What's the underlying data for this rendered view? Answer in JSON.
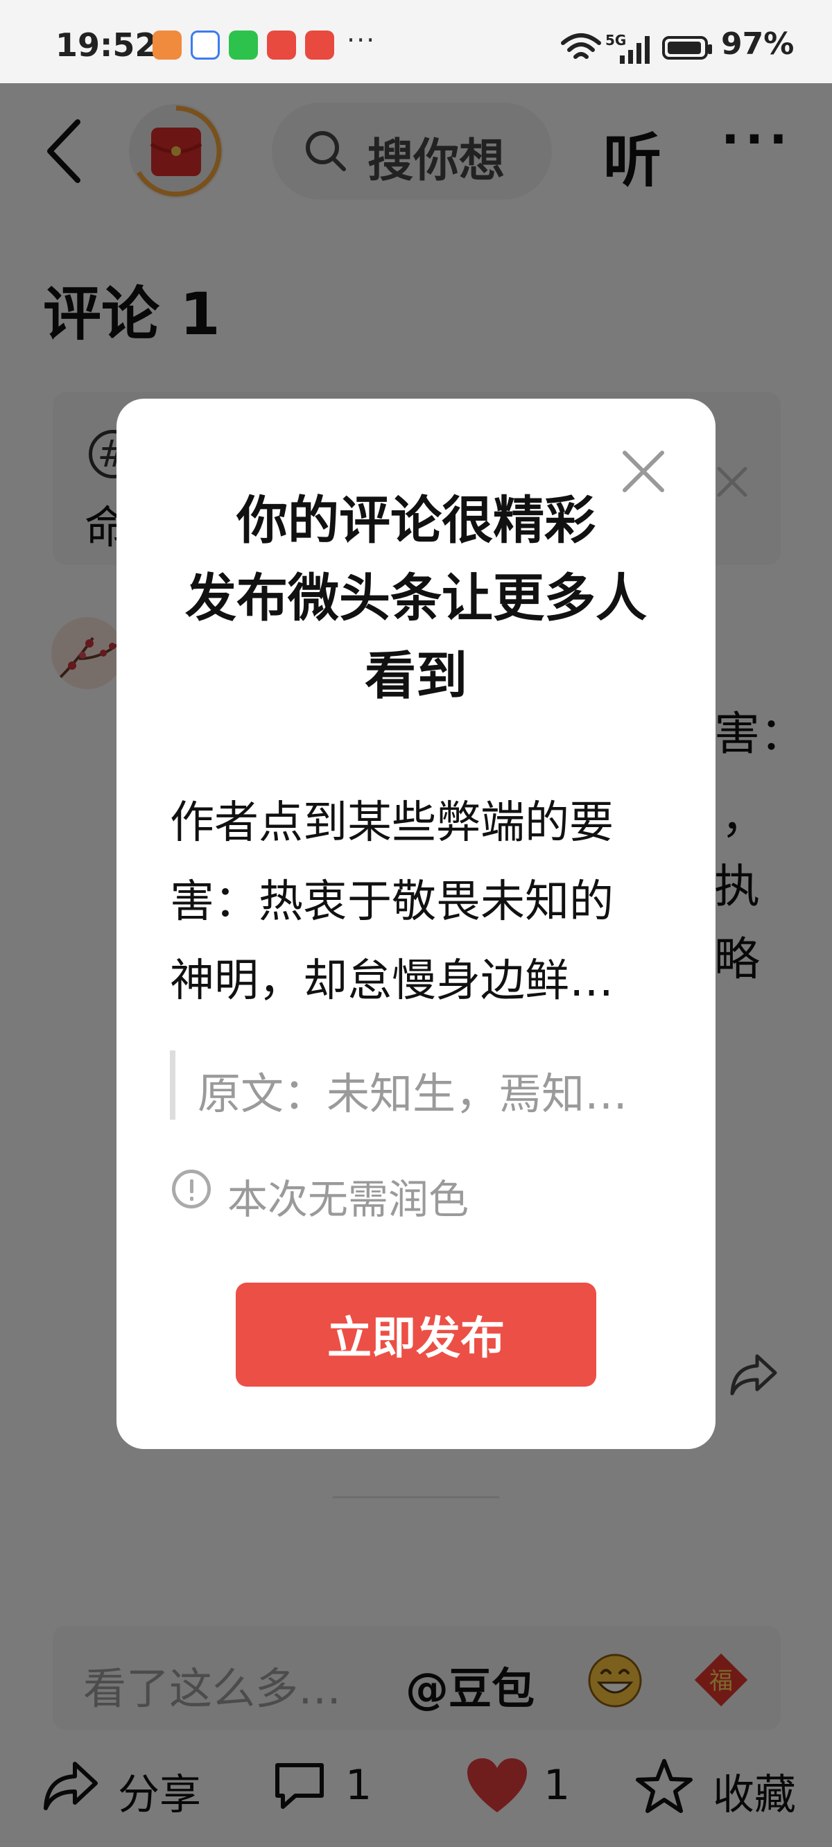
{
  "status_bar": {
    "time": "19:52",
    "network": "5G",
    "battery": "97%",
    "more_notifications": "···"
  },
  "header": {
    "search_placeholder": "搜你想",
    "listen_label": "听",
    "more_label": "···"
  },
  "page": {
    "title": "评论 1"
  },
  "background_comment": {
    "topic_fragment_1": "#",
    "topic_fragment_2": "命",
    "line_1": "害：",
    "line_2": "，",
    "line_3": "执",
    "line_4": "略"
  },
  "comment_input": {
    "placeholder": "看了这么多…",
    "mention": "@豆包"
  },
  "bottom_bar": {
    "share_label": "分享",
    "comment_count": "1",
    "like_count": "1",
    "favorite_label": "收藏"
  },
  "modal": {
    "title_lines": [
      "你的评论很精彩",
      "发布微头条让更多人",
      "看到"
    ],
    "preview_lines": [
      "作者点到某些弊端的要",
      "害：热衷于敬畏未知的",
      "神明，却怠慢身边鲜…"
    ],
    "original_quote": "原文：未知生，焉知…",
    "info_text": "本次无需润色",
    "publish_label": "立即发布"
  },
  "colors": {
    "accent": "#EC4F45",
    "like": "#E03A3A",
    "overlay": "rgba(0,0,0,0.5)"
  }
}
